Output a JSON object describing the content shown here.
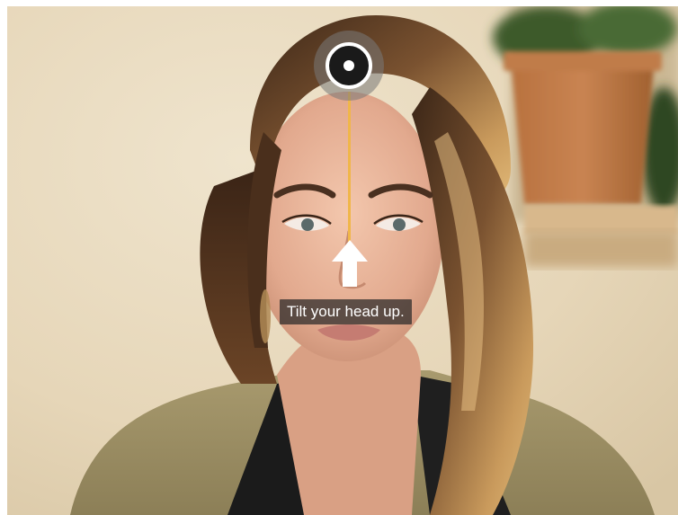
{
  "camera": {
    "hint_text": "Tilt your head up."
  },
  "overlay": {
    "target_icon": "target-icon",
    "arrow_icon": "arrow-up-icon",
    "guide_color": "#f0b649"
  }
}
